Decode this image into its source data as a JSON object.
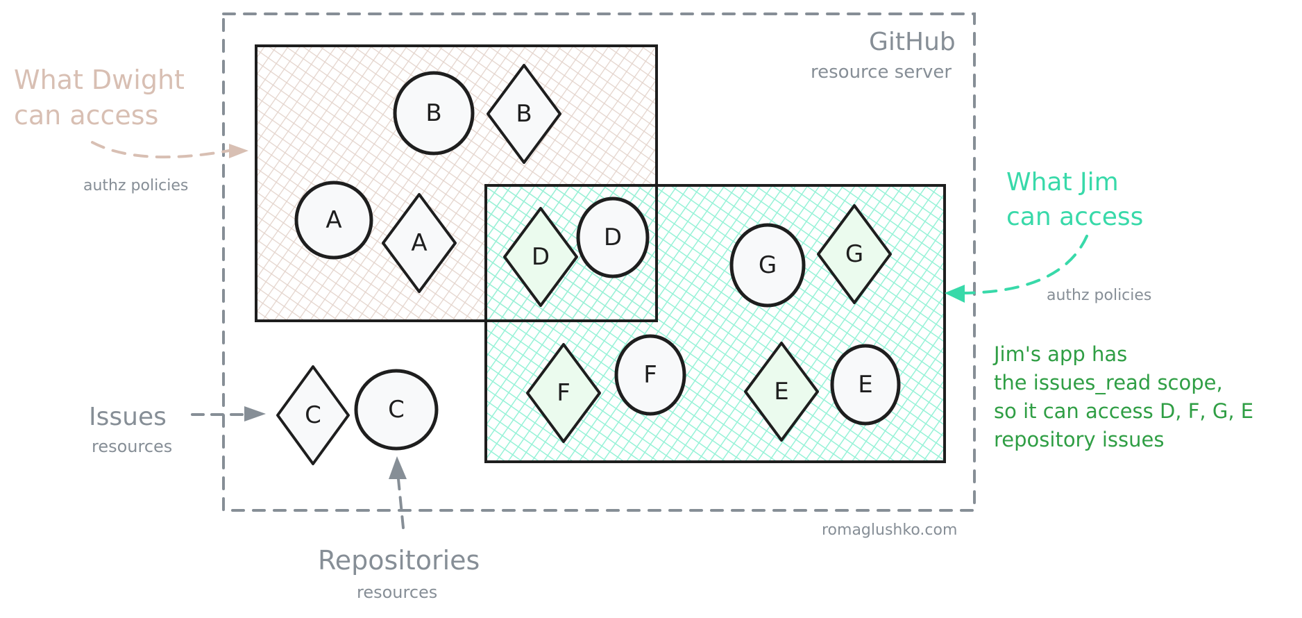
{
  "server": {
    "title": "GitHub",
    "subtitle": "resource server"
  },
  "dwight": {
    "label_line1": "What Dwight",
    "label_line2": "can access",
    "policy_label": "authz policies",
    "color": "#d8bfb3"
  },
  "jim": {
    "label_line1": "What Jim",
    "label_line2": "can access",
    "policy_label": "authz policies",
    "color": "#38d9a9"
  },
  "issues": {
    "title": "Issues",
    "subtitle": "resources"
  },
  "repositories": {
    "title": "Repositories",
    "subtitle": "resources"
  },
  "note": {
    "lines": [
      "Jim's app has",
      "the issues_read scope,",
      "so it can access D, F, G, E",
      "repository issues"
    ],
    "color": "#2f9e44"
  },
  "watermark": "romaglushko.com",
  "resources": [
    {
      "id": "B",
      "repository": "B",
      "issue": "B",
      "group": "dwight"
    },
    {
      "id": "A",
      "repository": "A",
      "issue": "A",
      "group": "dwight"
    },
    {
      "id": "D",
      "repository": "D",
      "issue": "D",
      "group": "both"
    },
    {
      "id": "G",
      "repository": "G",
      "issue": "G",
      "group": "jim"
    },
    {
      "id": "F",
      "repository": "F",
      "issue": "F",
      "group": "jim"
    },
    {
      "id": "E",
      "repository": "E",
      "issue": "E",
      "group": "jim"
    },
    {
      "id": "C",
      "repository": "C",
      "issue": "C",
      "group": "none"
    }
  ],
  "colors": {
    "gray": "#868e96",
    "stroke": "#1e1e1e",
    "repo_fill": "#f8f9fa",
    "issue_fill_jim": "#ebfbee"
  }
}
